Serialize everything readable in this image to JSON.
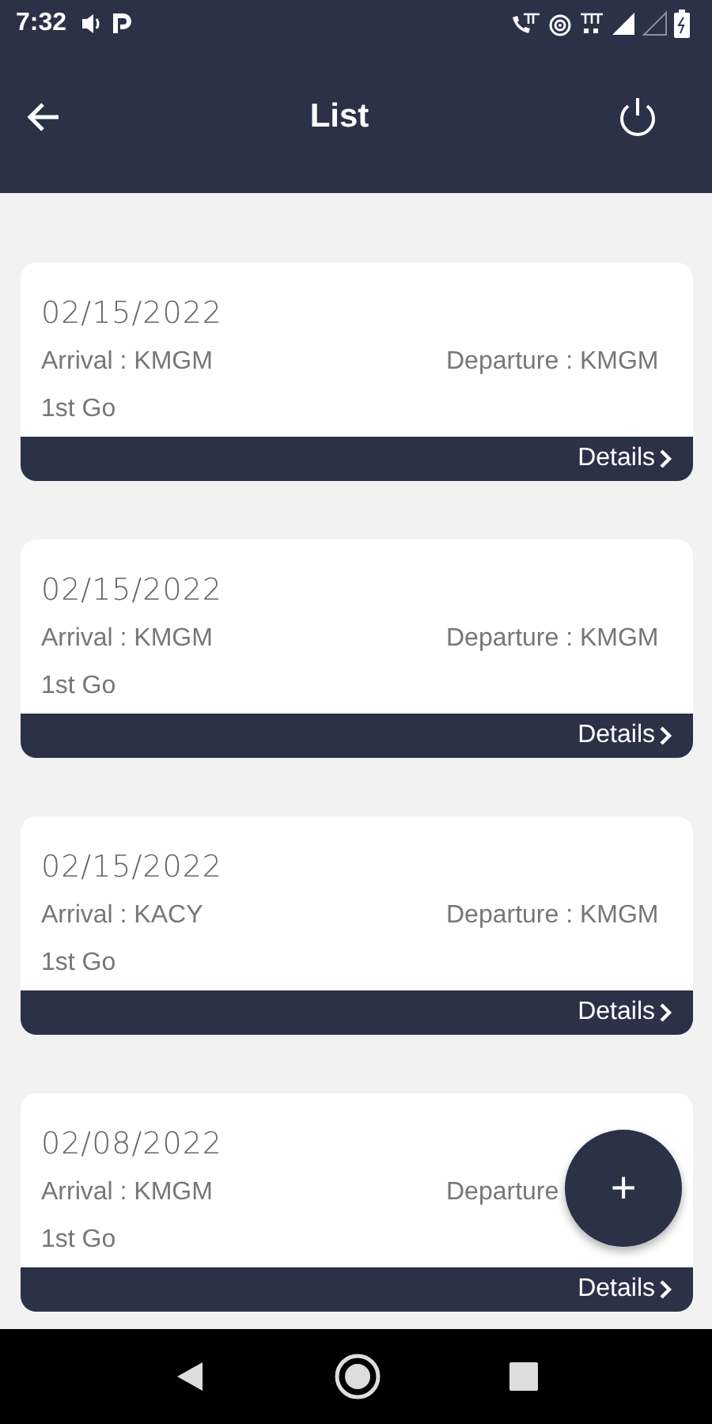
{
  "status_bar": {
    "time": "7:32"
  },
  "app_bar": {
    "title": "List"
  },
  "entries": [
    {
      "date": "02/15/2022",
      "arrival": "Arrival : KMGM",
      "departure": "Departure : KMGM",
      "note": "1st Go",
      "action": "Details"
    },
    {
      "date": "02/15/2022",
      "arrival": "Arrival : KMGM",
      "departure": "Departure : KMGM",
      "note": "1st Go",
      "action": "Details"
    },
    {
      "date": "02/15/2022",
      "arrival": "Arrival : KACY",
      "departure": "Departure : KMGM",
      "note": "1st Go",
      "action": "Details"
    },
    {
      "date": "02/08/2022",
      "arrival": "Arrival : KMGM",
      "departure": "Departure",
      "note": "1st Go",
      "action": "Details"
    }
  ],
  "fab": {
    "label": "+"
  }
}
